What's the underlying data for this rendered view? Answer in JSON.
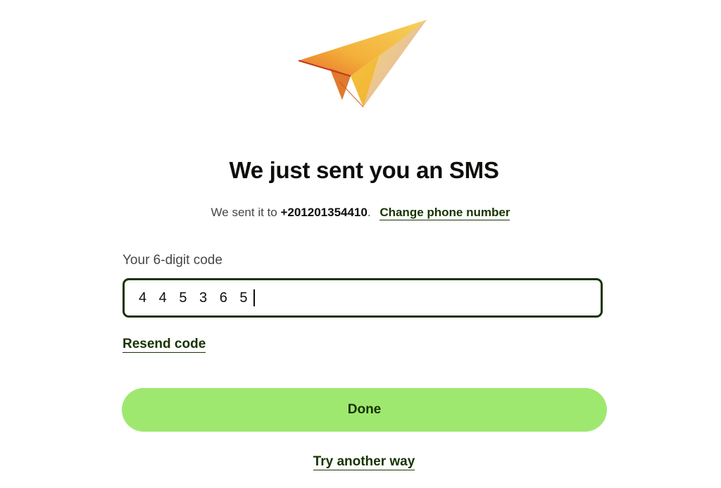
{
  "title": "We just sent you an SMS",
  "subtitle": {
    "prefix": "We sent it to ",
    "phone": "+201201354410",
    "suffix": ".",
    "change_link": "Change phone number"
  },
  "code_field": {
    "label": "Your 6-digit code",
    "value": "4 4 5 3 6 5"
  },
  "resend_link": "Resend code",
  "done_button": "Done",
  "try_another_link": "Try another way",
  "logo_icon": "paper-plane-icon",
  "colors": {
    "accent_green": "#9fe870",
    "dark_green": "#163300",
    "text": "#0e0f0c",
    "muted_text": "#454745"
  }
}
